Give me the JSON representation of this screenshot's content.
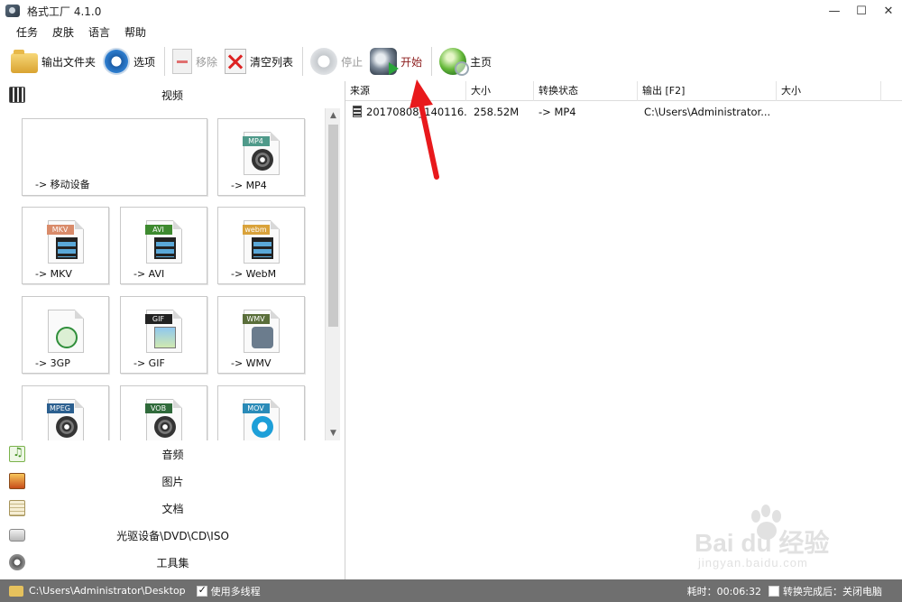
{
  "window": {
    "title": "格式工厂 4.1.0",
    "controls": {
      "minimize": "—",
      "maximize": "☐",
      "close": "✕"
    }
  },
  "menu": [
    "任务",
    "皮肤",
    "语言",
    "帮助"
  ],
  "toolbar": {
    "output_folder": "输出文件夹",
    "options": "选项",
    "remove": "移除",
    "clear_list": "清空列表",
    "stop": "停止",
    "start": "开始",
    "home": "主页"
  },
  "categories": {
    "video": "视频",
    "audio": "音频",
    "image": "图片",
    "document": "文档",
    "disc": "光驱设备\\DVD\\CD\\ISO",
    "tools": "工具集"
  },
  "video_tiles": [
    {
      "label": "-> 移动设备",
      "tag": "",
      "icon": "mobile-device-icon"
    },
    {
      "label": "-> MP4",
      "tag": "MP4",
      "icon": "mp4-file-icon"
    },
    {
      "label": "-> MKV",
      "tag": "MKV",
      "icon": "mkv-file-icon"
    },
    {
      "label": "-> AVI",
      "tag": "AVI",
      "icon": "avi-file-icon"
    },
    {
      "label": "-> WebM",
      "tag": "webm",
      "icon": "webm-file-icon"
    },
    {
      "label": "-> 3GP",
      "tag": "",
      "icon": "3gp-file-icon"
    },
    {
      "label": "-> GIF",
      "tag": "GIF",
      "icon": "gif-file-icon"
    },
    {
      "label": "-> WMV",
      "tag": "WMV",
      "icon": "wmv-file-icon"
    },
    {
      "label": "",
      "tag": "MPEG",
      "icon": "mpeg-file-icon"
    },
    {
      "label": "",
      "tag": "VOB",
      "icon": "vob-file-icon"
    },
    {
      "label": "",
      "tag": "MOV",
      "icon": "mov-file-icon"
    }
  ],
  "task_list": {
    "columns": [
      "来源",
      "大小",
      "转换状态",
      "输出 [F2]",
      "大小"
    ],
    "rows": [
      {
        "source": "20170808_140116...",
        "size": "258.52M",
        "status": "-> MP4",
        "output": "C:\\Users\\Administrator...",
        "out_size": ""
      }
    ]
  },
  "statusbar": {
    "path": "C:\\Users\\Administrator\\Desktop",
    "multithread_label": "使用多线程",
    "multithread_checked": true,
    "elapsed_label": "耗时：00:06:32",
    "after_label": "转换完成后：关闭电脑"
  },
  "watermark": {
    "main": "Bai du 经验",
    "sub": "jingyan.baidu.com"
  },
  "colors": {
    "status_bar": "#6f6f6f",
    "arrow": "#e8191c",
    "start_text": "#8b1b1b"
  }
}
